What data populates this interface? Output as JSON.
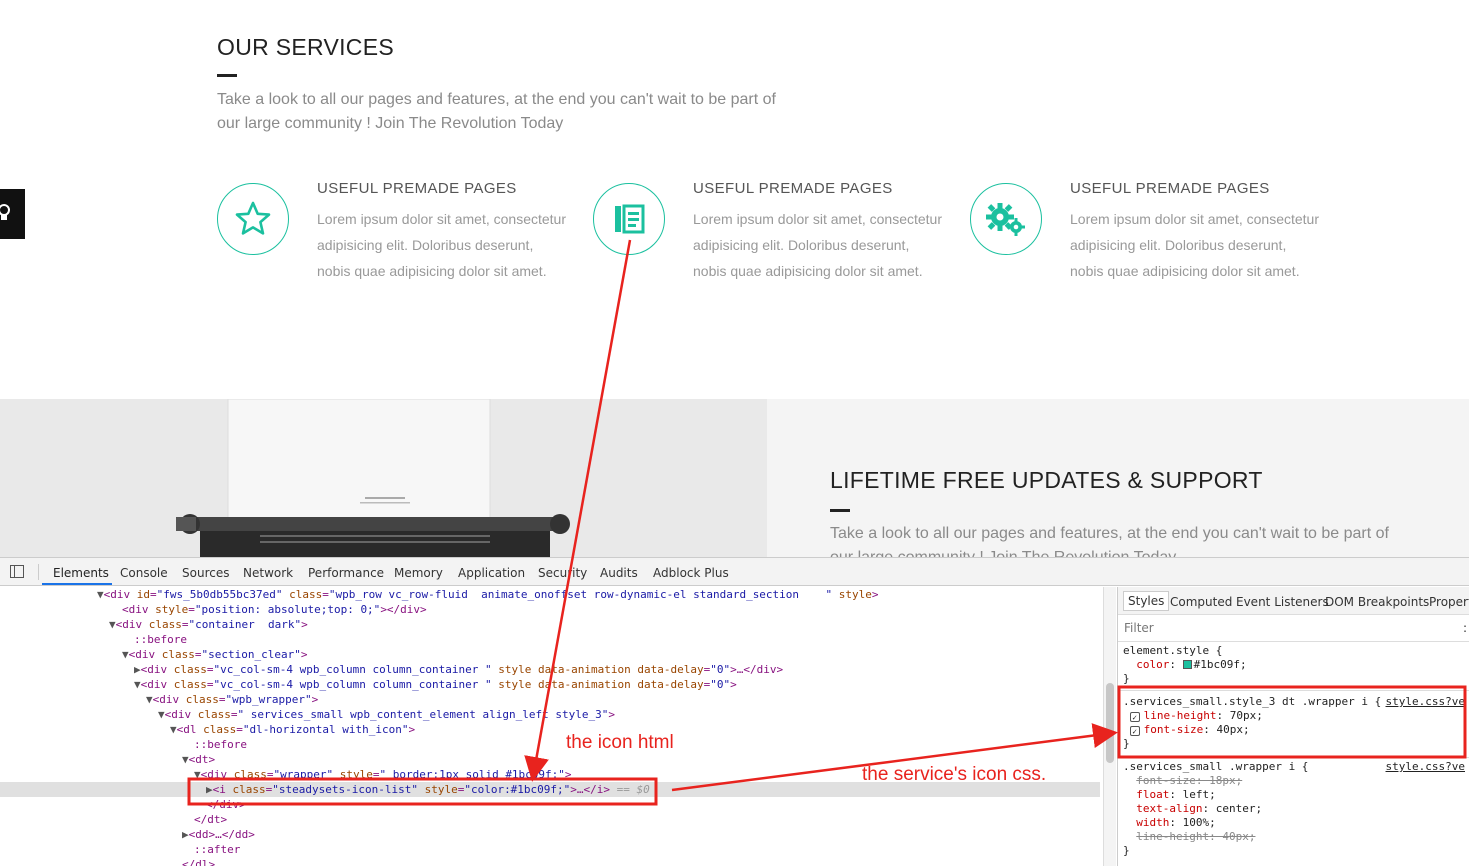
{
  "page": {
    "services_title": "OUR SERVICES",
    "intro_line1": "Take a look to all our pages and features, at the end you can't wait to be part of",
    "intro_line2": "our large community ! Join The Revolution Today",
    "services": [
      {
        "icon": "star-icon",
        "title": "USEFUL PREMADE PAGES",
        "text": "Lorem ipsum dolor sit amet, consectetur adipisicing elit. Doloribus deserunt, nobis quae adipisicing dolor sit amet."
      },
      {
        "icon": "list-icon",
        "title": "USEFUL PREMADE PAGES",
        "text": "Lorem ipsum dolor sit amet, consectetur adipisicing elit. Doloribus deserunt, nobis quae adipisicing dolor sit amet."
      },
      {
        "icon": "gears-icon",
        "title": "USEFUL PREMADE PAGES",
        "text": "Lorem ipsum dolor sit amet, consectetur adipisicing elit. Doloribus deserunt, nobis quae adipisicing dolor sit amet."
      }
    ],
    "lifetime_title": "LIFETIME FREE UPDATES & SUPPORT",
    "lifetime_line1": "Take a look to all our pages and features, at the end you can't wait to be part of",
    "lifetime_line2": "our large community ! Join The Revolution Today",
    "accent_color": "#1bc09f"
  },
  "devtools": {
    "tabs": [
      "Elements",
      "Console",
      "Sources",
      "Network",
      "Performance",
      "Memory",
      "Application",
      "Security",
      "Audits",
      "Adblock Plus"
    ],
    "active_tab": "Elements",
    "styles_tabs": [
      "Styles",
      "Computed",
      "Event Listeners",
      "DOM Breakpoints",
      "Propert"
    ],
    "filter_placeholder": "Filter",
    "filter_right": ":"
  },
  "annotations": {
    "icon_html": "the icon html",
    "icon_css": "the service's icon css.",
    "color": "#e8231e"
  }
}
